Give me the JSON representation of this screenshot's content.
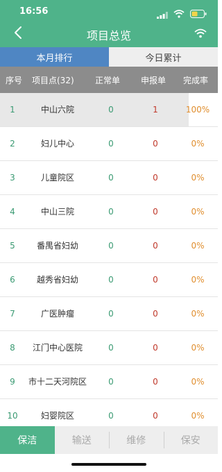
{
  "status_bar": {
    "time": "16:56"
  },
  "nav": {
    "title": "项目总览"
  },
  "tabs": [
    {
      "label": "本月排行",
      "active": true
    },
    {
      "label": "今日累计",
      "active": false
    }
  ],
  "table": {
    "headers": [
      "序号",
      "项目点(32)",
      "正常单",
      "申报单",
      "完成率"
    ],
    "rows": [
      {
        "no": "1",
        "name": "中山六院",
        "normal": "0",
        "report": "1",
        "rate": "100%"
      },
      {
        "no": "2",
        "name": "妇儿中心",
        "normal": "0",
        "report": "0",
        "rate": "0%"
      },
      {
        "no": "3",
        "name": "儿童院区",
        "normal": "0",
        "report": "0",
        "rate": "0%"
      },
      {
        "no": "4",
        "name": "中山三院",
        "normal": "0",
        "report": "0",
        "rate": "0%"
      },
      {
        "no": "5",
        "name": "番禺省妇幼",
        "normal": "0",
        "report": "0",
        "rate": "0%"
      },
      {
        "no": "6",
        "name": "越秀省妇幼",
        "normal": "0",
        "report": "0",
        "rate": "0%"
      },
      {
        "no": "7",
        "name": "广医肿瘤",
        "normal": "0",
        "report": "0",
        "rate": "0%"
      },
      {
        "no": "8",
        "name": "江门中心医院",
        "normal": "0",
        "report": "0",
        "rate": "0%"
      },
      {
        "no": "9",
        "name": "市十二天河院区",
        "normal": "0",
        "report": "0",
        "rate": "0%"
      },
      {
        "no": "10",
        "name": "妇婴院区",
        "normal": "0",
        "report": "0",
        "rate": "0%"
      }
    ]
  },
  "bottom_tabs": [
    {
      "label": "保洁",
      "active": true
    },
    {
      "label": "输送",
      "active": false
    },
    {
      "label": "维修",
      "active": false
    },
    {
      "label": "保安",
      "active": false
    }
  ],
  "colors": {
    "primary_green": "#4fb38a",
    "tab_blue": "#4f86c3",
    "header_gray": "#8c8c8c",
    "value_green": "#3a9a72",
    "value_red": "#c0392b",
    "rate_orange": "#e08e2e"
  },
  "icons": {
    "back": "chevron-left-icon",
    "nav_right": "wifi-icon",
    "signal": "signal-icon",
    "battery": "battery-icon"
  }
}
